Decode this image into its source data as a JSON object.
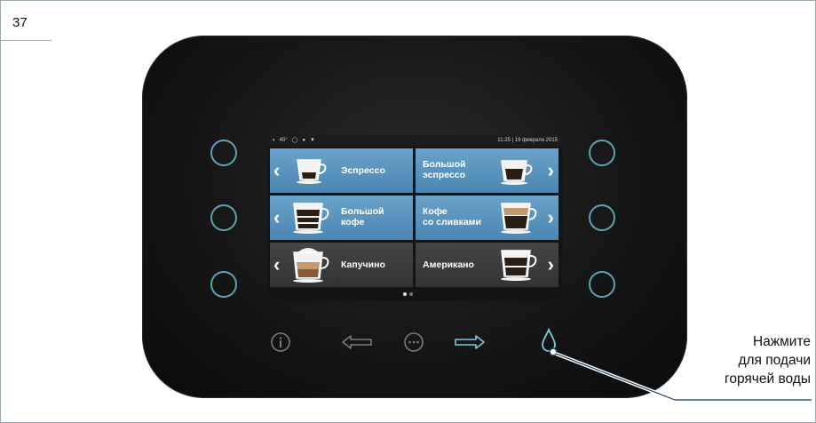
{
  "page_number": "37",
  "status_bar": {
    "temperature": "45°",
    "datetime": "11:25 | 19 февраля 2015"
  },
  "drinks": [
    {
      "label": "Эспрессо"
    },
    {
      "label_line1": "Большой",
      "label_line2": "эспрессо"
    },
    {
      "label_line1": "Большой",
      "label_line2": "кофе"
    },
    {
      "label_line1": "Кофе",
      "label_line2": "со сливками"
    },
    {
      "label": "Капучино"
    },
    {
      "label": "Американо"
    }
  ],
  "callout": {
    "line1": "Нажмите",
    "line2": "для подачи",
    "line3": "горячей воды"
  },
  "colors": {
    "tile_blue": "#5a95bf",
    "button_ring": "#5fa3b3",
    "highlight_icon": "#7ec8e3"
  },
  "icons": [
    "info-icon",
    "left-arrow-icon",
    "more-icon",
    "right-arrow-icon",
    "hot-water-drop-icon"
  ]
}
